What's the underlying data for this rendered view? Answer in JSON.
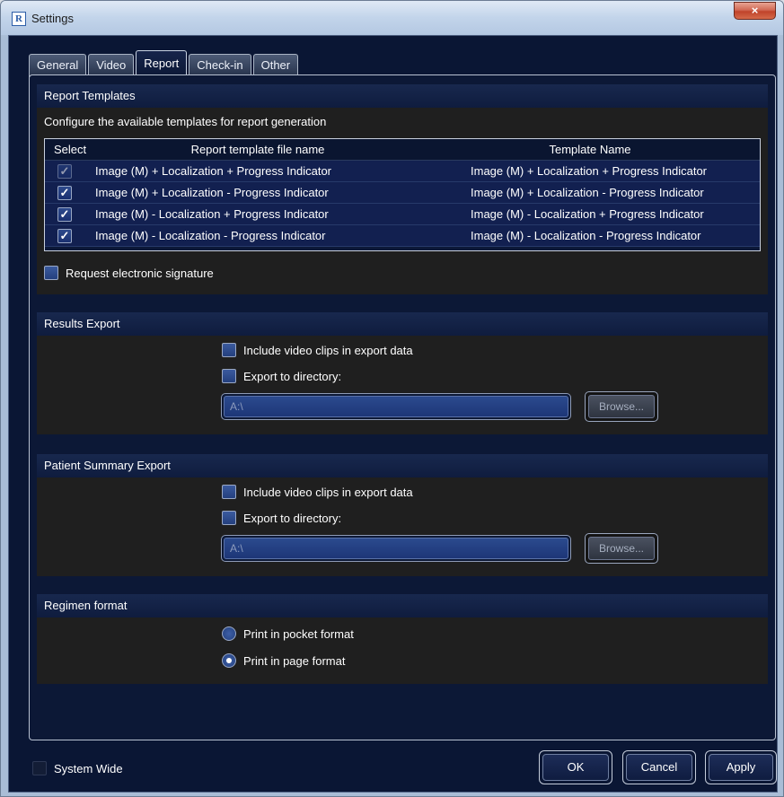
{
  "window": {
    "title": "Settings",
    "app_icon_letter": "R",
    "close_glyph": "×"
  },
  "tabs": [
    {
      "label": "General",
      "active": false
    },
    {
      "label": "Video",
      "active": false
    },
    {
      "label": "Report",
      "active": true
    },
    {
      "label": "Check-in",
      "active": false
    },
    {
      "label": "Other",
      "active": false
    }
  ],
  "report_templates": {
    "header": "Report Templates",
    "description": "Configure the available templates for report generation",
    "columns": {
      "select": "Select",
      "file": "Report template file name",
      "name": "Template Name"
    },
    "rows": [
      {
        "checked": true,
        "disabled": true,
        "file": "Image (M) + Localization + Progress Indicator",
        "name": "Image (M) + Localization + Progress Indicator"
      },
      {
        "checked": true,
        "disabled": false,
        "file": "Image (M) + Localization - Progress Indicator",
        "name": "Image (M) + Localization - Progress Indicator"
      },
      {
        "checked": true,
        "disabled": false,
        "file": "Image (M) - Localization + Progress Indicator",
        "name": "Image (M) - Localization + Progress Indicator"
      },
      {
        "checked": true,
        "disabled": false,
        "file": "Image (M) - Localization - Progress Indicator",
        "name": "Image (M) - Localization - Progress Indicator"
      }
    ],
    "signature_label": "Request electronic signature"
  },
  "results_export": {
    "header": "Results Export",
    "include_clips_label": "Include video clips in export data",
    "export_dir_label": "Export to directory:",
    "dir_value": "A:\\",
    "browse_label": "Browse..."
  },
  "patient_export": {
    "header": "Patient Summary Export",
    "include_clips_label": "Include video clips in export data",
    "export_dir_label": "Export to directory:",
    "dir_value": "A:\\",
    "browse_label": "Browse..."
  },
  "regimen": {
    "header": "Regimen format",
    "pocket_label": "Print in pocket format",
    "page_label": "Print in page format",
    "selected": "page"
  },
  "footer": {
    "system_wide_label": "System Wide",
    "ok_label": "OK",
    "cancel_label": "Cancel",
    "apply_label": "Apply"
  },
  "check_glyph": "✓"
}
